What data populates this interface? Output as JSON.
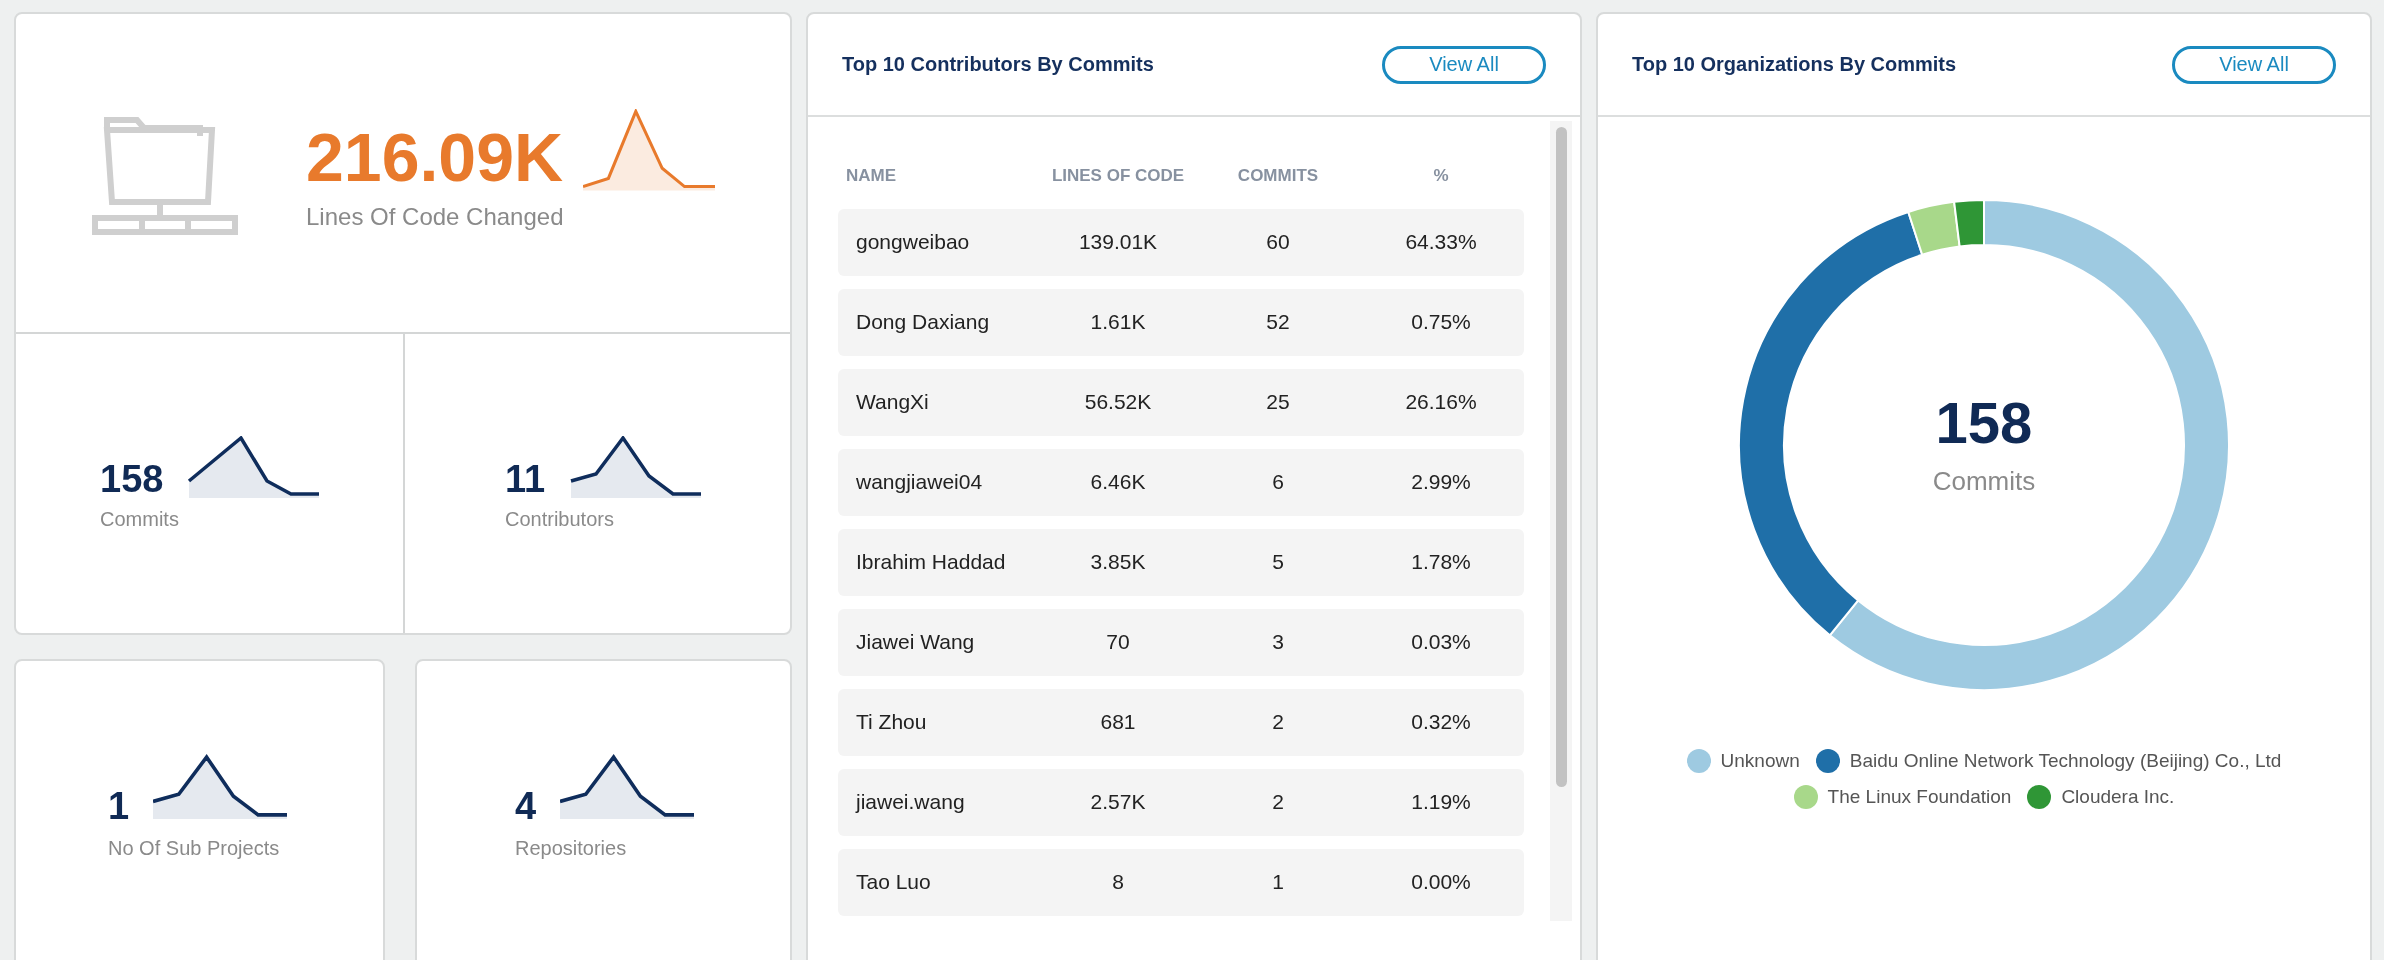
{
  "summary": {
    "value": "216.09K",
    "label": "Lines Of Code Changed"
  },
  "stats": [
    {
      "value": "158",
      "label": "Commits"
    },
    {
      "value": "11",
      "label": "Contributors"
    }
  ],
  "bottom_stats": [
    {
      "value": "1",
      "label": "No Of Sub Projects"
    },
    {
      "value": "4",
      "label": "Repositories"
    }
  ],
  "contributors": {
    "title": "Top 10 Contributors By Commits",
    "button": "View All",
    "columns": [
      "NAME",
      "LINES OF CODE",
      "COMMITS",
      "%"
    ],
    "rows": [
      [
        "gongweibao",
        "139.01K",
        "60",
        "64.33%"
      ],
      [
        "Dong Daxiang",
        "1.61K",
        "52",
        "0.75%"
      ],
      [
        "WangXi",
        "56.52K",
        "25",
        "26.16%"
      ],
      [
        "wangjiawei04",
        "6.46K",
        "6",
        "2.99%"
      ],
      [
        "Ibrahim Haddad",
        "3.85K",
        "5",
        "1.78%"
      ],
      [
        "Jiawei Wang",
        "70",
        "3",
        "0.03%"
      ],
      [
        "Ti Zhou",
        "681",
        "2",
        "0.32%"
      ],
      [
        "jiawei.wang",
        "2.57K",
        "2",
        "1.19%"
      ],
      [
        "Tao Luo",
        "8",
        "1",
        "0.00%"
      ]
    ]
  },
  "organizations": {
    "title": "Top 10 Organizations By Commits",
    "button": "View All",
    "center_value": "158",
    "center_label": "Commits",
    "legend": [
      {
        "name": "Unknown",
        "color": "#9ecae1"
      },
      {
        "name": "Baidu Online Network Technology (Beijing) Co., Ltd",
        "color": "#1f6fa8"
      },
      {
        "name": "The Linux Foundation",
        "color": "#a8d88a"
      },
      {
        "name": "Cloudera Inc.",
        "color": "#2f9636"
      }
    ]
  }
}
